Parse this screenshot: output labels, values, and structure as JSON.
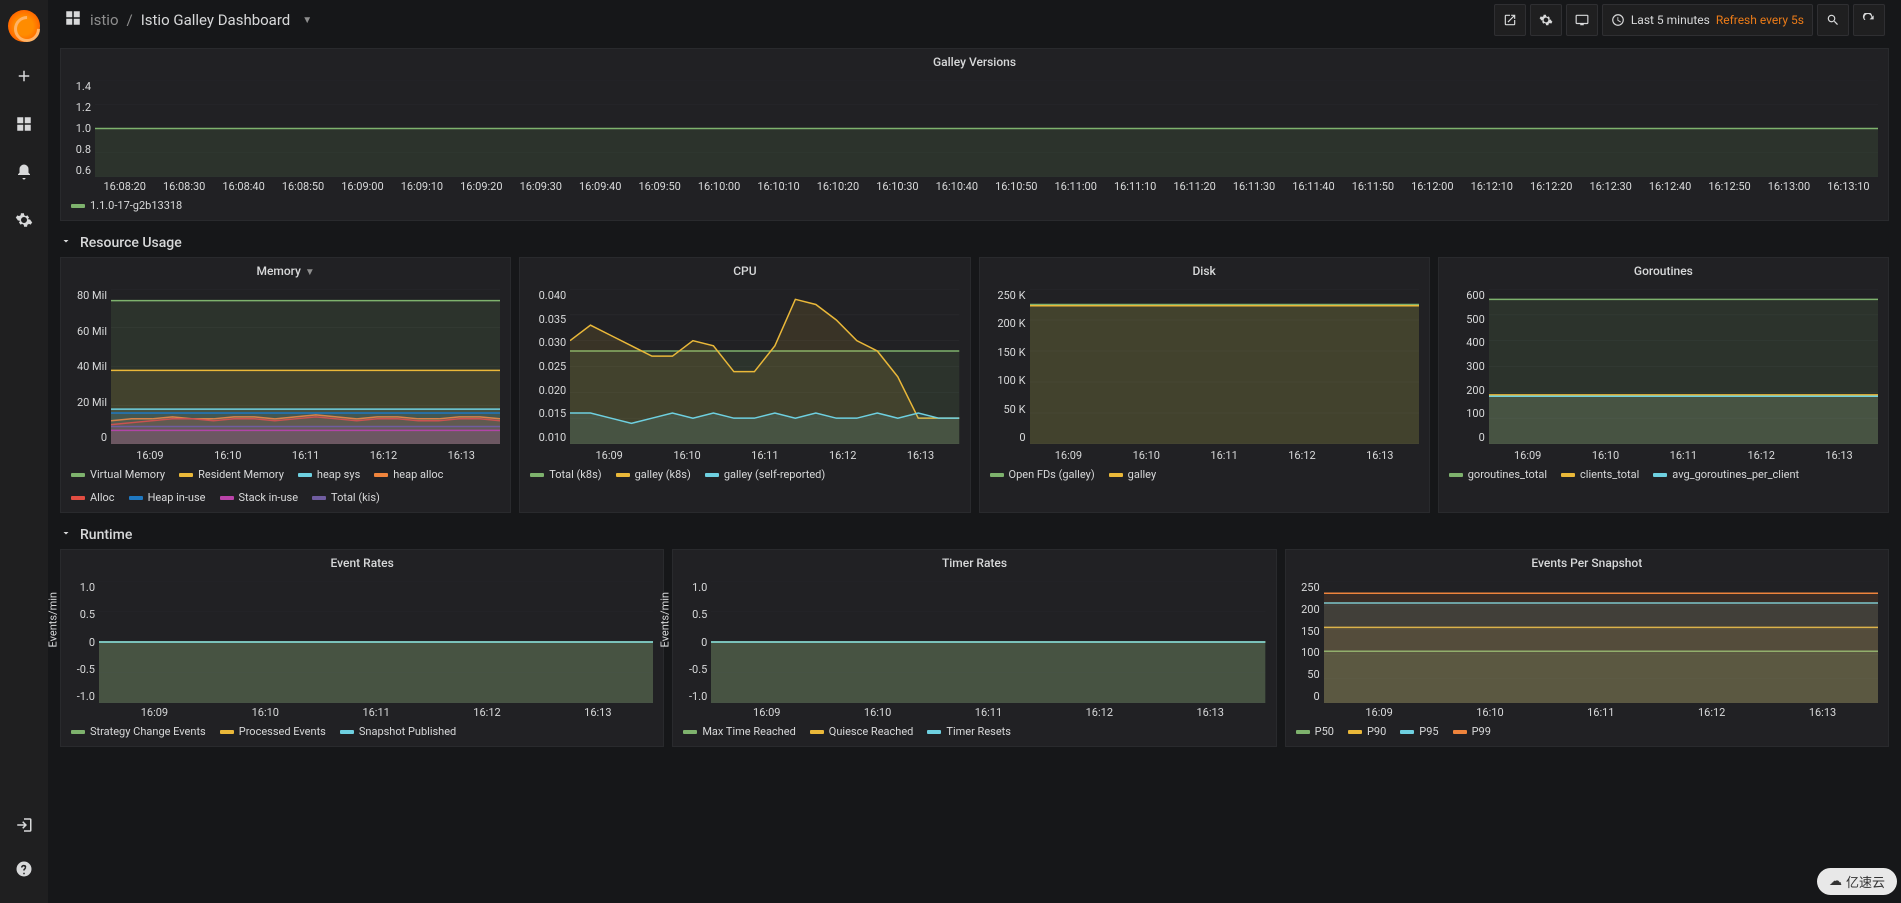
{
  "topbar": {
    "folder": "istio",
    "title": "Istio Galley Dashboard",
    "time_range": "Last 5 minutes",
    "refresh": "Refresh every 5s"
  },
  "rows": {
    "resource": "Resource Usage",
    "runtime": "Runtime"
  },
  "panels": {
    "versions": {
      "title": "Galley Versions",
      "legend": [
        "1.1.0-17-g2b13318"
      ]
    },
    "memory": {
      "title": "Memory",
      "legend": [
        "Virtual Memory",
        "Resident Memory",
        "heap sys",
        "heap alloc",
        "Alloc",
        "Heap in-use",
        "Stack in-use",
        "Total (kis)"
      ]
    },
    "cpu": {
      "title": "CPU",
      "legend": [
        "Total (k8s)",
        "galley (k8s)",
        "galley (self-reported)"
      ]
    },
    "disk": {
      "title": "Disk",
      "legend": [
        "Open FDs (galley)",
        "galley"
      ]
    },
    "goroutines": {
      "title": "Goroutines",
      "legend": [
        "goroutines_total",
        "clients_total",
        "avg_goroutines_per_client"
      ]
    },
    "event_rates": {
      "title": "Event Rates",
      "ylabel": "Events/min",
      "legend": [
        "Strategy Change Events",
        "Processed Events",
        "Snapshot Published"
      ]
    },
    "timer_rates": {
      "title": "Timer Rates",
      "ylabel": "Events/min",
      "legend": [
        "Max Time Reached",
        "Quiesce Reached",
        "Timer Resets"
      ]
    },
    "events_snapshot": {
      "title": "Events Per Snapshot",
      "legend": [
        "P50",
        "P90",
        "P95",
        "P99"
      ]
    }
  },
  "colors": {
    "green": "#7eb26d",
    "yellow": "#eab839",
    "cyan": "#6ed0e0",
    "orange": "#ef843c",
    "red": "#e24d42",
    "blue": "#1f78c1",
    "purple": "#ba43a9",
    "violet": "#705da0"
  },
  "watermark": "亿速云",
  "chart_data": [
    {
      "id": "versions",
      "type": "line",
      "x_ticks": [
        "16:08:20",
        "16:08:30",
        "16:08:40",
        "16:08:50",
        "16:09:00",
        "16:09:10",
        "16:09:20",
        "16:09:30",
        "16:09:40",
        "16:09:50",
        "16:10:00",
        "16:10:10",
        "16:10:20",
        "16:10:30",
        "16:10:40",
        "16:10:50",
        "16:11:00",
        "16:11:10",
        "16:11:20",
        "16:11:30",
        "16:11:40",
        "16:11:50",
        "16:12:00",
        "16:12:10",
        "16:12:20",
        "16:12:30",
        "16:12:40",
        "16:12:50",
        "16:13:00",
        "16:13:10"
      ],
      "y_ticks": [
        "0.6",
        "0.8",
        "1.0",
        "1.2",
        "1.4"
      ],
      "ylim": [
        0.6,
        1.4
      ],
      "series": [
        {
          "name": "1.1.0-17-g2b13318",
          "color": "green",
          "values": [
            1,
            1,
            1,
            1,
            1,
            1,
            1,
            1,
            1,
            1,
            1,
            1,
            1,
            1,
            1,
            1,
            1,
            1,
            1,
            1,
            1,
            1,
            1,
            1,
            1,
            1,
            1,
            1,
            1,
            1
          ]
        }
      ]
    },
    {
      "id": "memory",
      "type": "line",
      "x_ticks": [
        "16:09",
        "16:10",
        "16:11",
        "16:12",
        "16:13"
      ],
      "y_ticks": [
        "0",
        "20 Mil",
        "40 Mil",
        "60 Mil",
        "80 Mil"
      ],
      "ylim": [
        0,
        80
      ],
      "series": [
        {
          "name": "Virtual Memory",
          "color": "green",
          "values": [
            74,
            74,
            74,
            74,
            74,
            74,
            74,
            74,
            74,
            74,
            74,
            74,
            74,
            74,
            74,
            74,
            74,
            74,
            74,
            74
          ]
        },
        {
          "name": "Resident Memory",
          "color": "yellow",
          "values": [
            38,
            38,
            38,
            38,
            38,
            38,
            38,
            38,
            38,
            38,
            38,
            38,
            38,
            38,
            38,
            38,
            38,
            38,
            38,
            38
          ]
        },
        {
          "name": "heap sys",
          "color": "cyan",
          "values": [
            18,
            18,
            18,
            18,
            18,
            18,
            18,
            18,
            18,
            18,
            18,
            18,
            18,
            18,
            18,
            18,
            18,
            18,
            18,
            18
          ]
        },
        {
          "name": "heap alloc",
          "color": "orange",
          "values": [
            12,
            13,
            13,
            14,
            13,
            13,
            14,
            14,
            13,
            14,
            15,
            14,
            13,
            14,
            14,
            13,
            13,
            14,
            14,
            13
          ]
        },
        {
          "name": "Alloc",
          "color": "red",
          "values": [
            10,
            11,
            12,
            13,
            13,
            12,
            13,
            13,
            12,
            13,
            14,
            13,
            12,
            13,
            13,
            12,
            12,
            13,
            13,
            12
          ]
        },
        {
          "name": "Heap in-use",
          "color": "blue",
          "values": [
            16,
            16,
            16,
            16,
            16,
            16,
            16,
            16,
            16,
            16,
            16,
            16,
            16,
            16,
            16,
            16,
            16,
            16,
            16,
            16
          ]
        },
        {
          "name": "Stack in-use",
          "color": "purple",
          "values": [
            7,
            7,
            7,
            7,
            7,
            7,
            7,
            7,
            7,
            7,
            7,
            7,
            7,
            7,
            7,
            7,
            7,
            7,
            7,
            7
          ]
        },
        {
          "name": "Total (kis)",
          "color": "violet",
          "values": [
            9,
            9,
            9,
            9,
            9,
            9,
            9,
            9,
            9,
            9,
            9,
            9,
            9,
            9,
            9,
            9,
            9,
            9,
            9,
            9
          ]
        }
      ]
    },
    {
      "id": "cpu",
      "type": "line",
      "x_ticks": [
        "16:09",
        "16:10",
        "16:11",
        "16:12",
        "16:13"
      ],
      "y_ticks": [
        "0.010",
        "0.015",
        "0.020",
        "0.025",
        "0.030",
        "0.035",
        "0.040"
      ],
      "ylim": [
        0.01,
        0.04
      ],
      "series": [
        {
          "name": "Total (k8s)",
          "color": "green",
          "values": [
            0.028,
            0.028,
            0.028,
            0.028,
            0.028,
            0.028,
            0.028,
            0.028,
            0.028,
            0.028,
            0.028,
            0.028,
            0.028,
            0.028,
            0.028,
            0.028,
            0.028,
            0.028,
            0.028,
            0.028
          ]
        },
        {
          "name": "galley (k8s)",
          "color": "yellow",
          "values": [
            0.03,
            0.033,
            0.031,
            0.029,
            0.027,
            0.027,
            0.03,
            0.029,
            0.024,
            0.024,
            0.029,
            0.038,
            0.037,
            0.034,
            0.03,
            0.028,
            0.023,
            0.015,
            0.015,
            0.015
          ]
        },
        {
          "name": "galley (self-reported)",
          "color": "cyan",
          "values": [
            0.016,
            0.016,
            0.015,
            0.014,
            0.015,
            0.016,
            0.015,
            0.016,
            0.015,
            0.015,
            0.016,
            0.015,
            0.016,
            0.015,
            0.015,
            0.016,
            0.015,
            0.016,
            0.015,
            0.015
          ]
        }
      ]
    },
    {
      "id": "disk",
      "type": "line",
      "x_ticks": [
        "16:09",
        "16:10",
        "16:11",
        "16:12",
        "16:13"
      ],
      "y_ticks": [
        "0",
        "50 K",
        "100 K",
        "150 K",
        "200 K",
        "250 K"
      ],
      "ylim": [
        0,
        250
      ],
      "series": [
        {
          "name": "Open FDs (galley)",
          "color": "green",
          "values": [
            225,
            225,
            225,
            225,
            225,
            225,
            225,
            225,
            225,
            225,
            225,
            225,
            225,
            225,
            225,
            225,
            225,
            225,
            225,
            225
          ]
        },
        {
          "name": "galley",
          "color": "yellow",
          "values": [
            223,
            223,
            223,
            223,
            223,
            223,
            223,
            223,
            223,
            223,
            223,
            223,
            223,
            223,
            223,
            223,
            223,
            223,
            223,
            223
          ]
        }
      ]
    },
    {
      "id": "goroutines",
      "type": "line",
      "x_ticks": [
        "16:09",
        "16:10",
        "16:11",
        "16:12",
        "16:13"
      ],
      "y_ticks": [
        "0",
        "100",
        "200",
        "300",
        "400",
        "500",
        "600"
      ],
      "ylim": [
        0,
        600
      ],
      "series": [
        {
          "name": "goroutines_total",
          "color": "green",
          "values": [
            560,
            560,
            560,
            560,
            560,
            560,
            560,
            560,
            560,
            560,
            560,
            560,
            560,
            560,
            560,
            560,
            560,
            560,
            560,
            560
          ]
        },
        {
          "name": "clients_total",
          "color": "yellow",
          "values": [
            190,
            190,
            190,
            190,
            190,
            190,
            190,
            190,
            190,
            190,
            190,
            190,
            190,
            190,
            190,
            190,
            190,
            190,
            190,
            190
          ]
        },
        {
          "name": "avg_goroutines_per_client",
          "color": "cyan",
          "values": [
            185,
            185,
            185,
            185,
            185,
            185,
            185,
            185,
            185,
            185,
            185,
            185,
            185,
            185,
            185,
            185,
            185,
            185,
            185,
            185
          ]
        }
      ]
    },
    {
      "id": "event_rates",
      "type": "line",
      "x_ticks": [
        "16:09",
        "16:10",
        "16:11",
        "16:12",
        "16:13"
      ],
      "y_ticks": [
        "-1.0",
        "-0.5",
        "0",
        "0.5",
        "1.0"
      ],
      "ylim": [
        -1,
        1
      ],
      "series": [
        {
          "name": "Strategy Change Events",
          "color": "green",
          "values": [
            0,
            0,
            0,
            0,
            0,
            0,
            0,
            0,
            0,
            0,
            0,
            0,
            0,
            0,
            0,
            0,
            0,
            0,
            0,
            0
          ]
        },
        {
          "name": "Processed Events",
          "color": "yellow",
          "values": [
            0,
            0,
            0,
            0,
            0,
            0,
            0,
            0,
            0,
            0,
            0,
            0,
            0,
            0,
            0,
            0,
            0,
            0,
            0,
            0
          ]
        },
        {
          "name": "Snapshot Published",
          "color": "cyan",
          "values": [
            0,
            0,
            0,
            0,
            0,
            0,
            0,
            0,
            0,
            0,
            0,
            0,
            0,
            0,
            0,
            0,
            0,
            0,
            0,
            0
          ]
        }
      ]
    },
    {
      "id": "timer_rates",
      "type": "line",
      "x_ticks": [
        "16:09",
        "16:10",
        "16:11",
        "16:12",
        "16:13"
      ],
      "y_ticks": [
        "-1.0",
        "-0.5",
        "0",
        "0.5",
        "1.0"
      ],
      "ylim": [
        -1,
        1
      ],
      "series": [
        {
          "name": "Max Time Reached",
          "color": "green",
          "values": [
            0,
            0,
            0,
            0,
            0,
            0,
            0,
            0,
            0,
            0,
            0,
            0,
            0,
            0,
            0,
            0,
            0,
            0,
            0,
            0
          ]
        },
        {
          "name": "Quiesce Reached",
          "color": "yellow",
          "values": [
            0,
            0,
            0,
            0,
            0,
            0,
            0,
            0,
            0,
            0,
            0,
            0,
            0,
            0,
            0,
            0,
            0,
            0,
            0,
            0
          ]
        },
        {
          "name": "Timer Resets",
          "color": "cyan",
          "values": [
            0,
            0,
            0,
            0,
            0,
            0,
            0,
            0,
            0,
            0,
            0,
            0,
            0,
            0,
            0,
            0,
            0,
            0,
            0,
            0
          ]
        }
      ]
    },
    {
      "id": "events_snapshot",
      "type": "line",
      "x_ticks": [
        "16:09",
        "16:10",
        "16:11",
        "16:12",
        "16:13"
      ],
      "y_ticks": [
        "0",
        "50",
        "100",
        "150",
        "200",
        "250"
      ],
      "ylim": [
        0,
        250
      ],
      "series": [
        {
          "name": "P50",
          "color": "green",
          "values": [
            106,
            106,
            106,
            106,
            106,
            106,
            106,
            106,
            106,
            106,
            106,
            106,
            106,
            106,
            106,
            106,
            106,
            106,
            106,
            106
          ]
        },
        {
          "name": "P90",
          "color": "yellow",
          "values": [
            155,
            155,
            155,
            155,
            155,
            155,
            155,
            155,
            155,
            155,
            155,
            155,
            155,
            155,
            155,
            155,
            155,
            155,
            155,
            155
          ]
        },
        {
          "name": "P95",
          "color": "cyan",
          "values": [
            205,
            205,
            205,
            205,
            205,
            205,
            205,
            205,
            205,
            205,
            205,
            205,
            205,
            205,
            205,
            205,
            205,
            205,
            205,
            205
          ]
        },
        {
          "name": "P99",
          "color": "orange",
          "values": [
            225,
            225,
            225,
            225,
            225,
            225,
            225,
            225,
            225,
            225,
            225,
            225,
            225,
            225,
            225,
            225,
            225,
            225,
            225,
            225
          ]
        }
      ]
    }
  ]
}
